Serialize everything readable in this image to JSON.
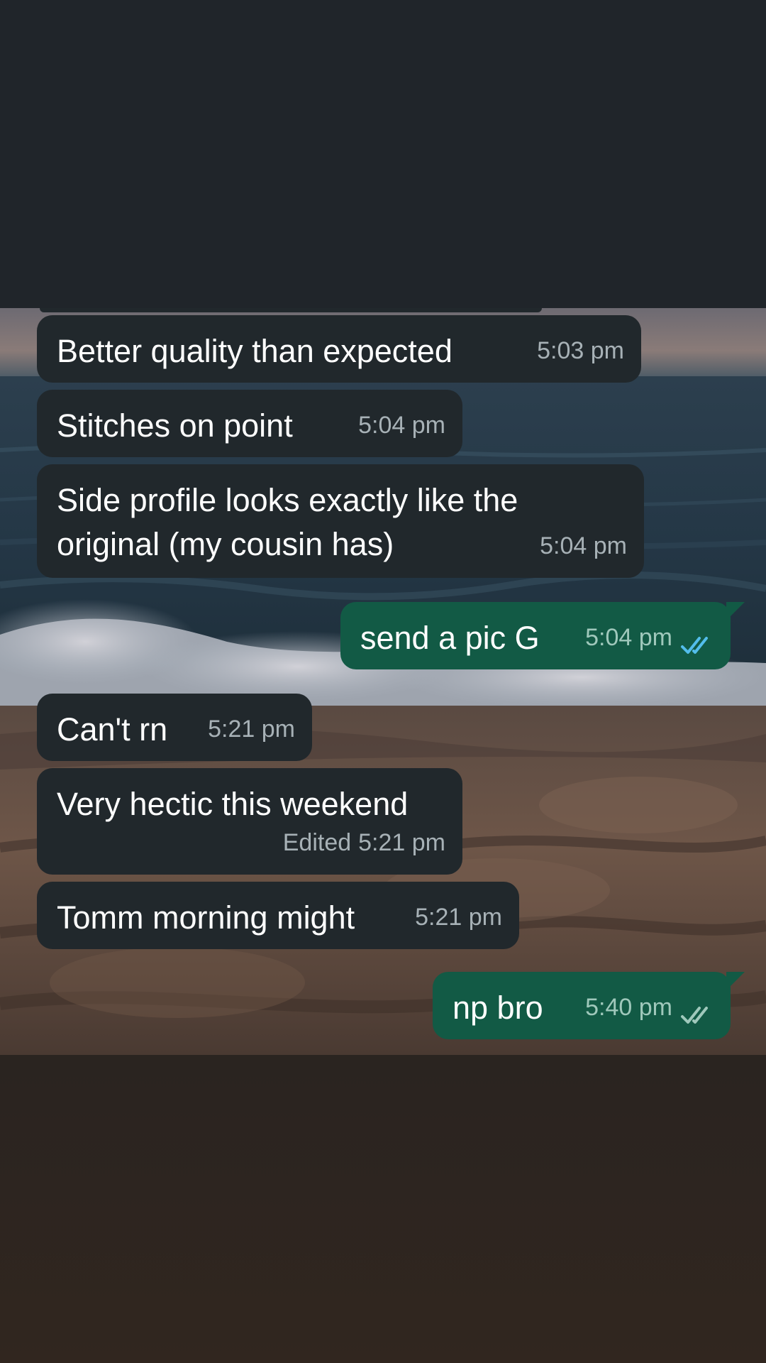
{
  "messages": [
    {
      "direction": "incoming",
      "text": "Better quality than expected",
      "time": "5:03 pm"
    },
    {
      "direction": "incoming",
      "text": "Stitches on point",
      "time": "5:04 pm"
    },
    {
      "direction": "incoming",
      "text": "Side profile looks exactly like the",
      "text2": "original (my cousin has)",
      "time": "5:04 pm"
    },
    {
      "direction": "outgoing",
      "text": "send a pic G",
      "time": "5:04 pm",
      "status": "read",
      "status_icon": "double-check-icon",
      "status_color": "#53bdeb"
    },
    {
      "direction": "incoming",
      "text": "Can't rn",
      "time": "5:21 pm"
    },
    {
      "direction": "incoming",
      "text": "Very hectic this weekend",
      "edited_label": "Edited",
      "time": "5:21 pm"
    },
    {
      "direction": "incoming",
      "text": "Tomm morning might",
      "time": "5:21 pm"
    },
    {
      "direction": "outgoing",
      "text": "np bro",
      "time": "5:40 pm",
      "status": "delivered",
      "status_icon": "double-check-icon",
      "status_color": "#9fc8bb"
    }
  ],
  "colors": {
    "incoming_bubble": "#21282c",
    "outgoing_bubble": "#125a45",
    "background": "#20252a"
  }
}
